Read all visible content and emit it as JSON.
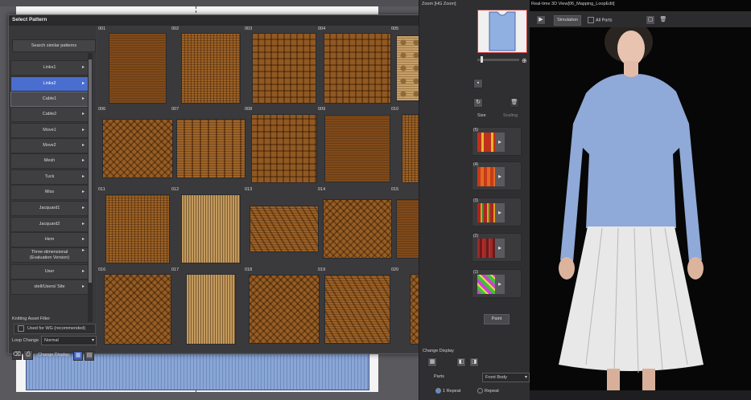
{
  "dialog": {
    "title": "Select Pattern",
    "search_similar": "Search similar patterns",
    "categories": [
      "Links1",
      "Links2",
      "Cable1",
      "Cable2",
      "Move1",
      "Move2",
      "Mesh",
      "Tuck",
      "Miss",
      "Jacquard1",
      "Jacquard2",
      "Hem",
      "Three-dimensional\n(Evaluation Version)",
      "User",
      "stell/Users/ Site"
    ],
    "selected_category": "Links2",
    "filter_label": "Knitting Asset Filter",
    "filter_checkbox": "Used for WG (recommended)",
    "loop_change_label": "Loop Change",
    "loop_change_value": "Normal",
    "change_display_label": "Change Display",
    "patterns": [
      "001",
      "002",
      "003",
      "004",
      "005",
      "006",
      "007",
      "008",
      "009",
      "010",
      "011",
      "012",
      "013",
      "014",
      "015",
      "016",
      "017",
      "018",
      "019",
      "020"
    ],
    "close_glyph": "×",
    "arrow_glyph": "▸",
    "dropdown_glyph": "▾"
  },
  "mid_panel": {
    "zoom_title": "Zoom [HG Zoom]",
    "size_label": "Size",
    "scaling_label": "Scaling",
    "layers": [
      "(5)",
      "(4)",
      "(3)",
      "(2)",
      "(1)"
    ],
    "paint_label": "Paint",
    "change_display": "Change Display",
    "parts_label": "Parts",
    "parts_value": "Front Body",
    "radio_1": "1 Repeat",
    "radio_2": "Repeat"
  },
  "view3d": {
    "title": "Real-time 3D View[06_Mapping_LoopEdit]",
    "simulation": "Simulation",
    "all_parts": "All Parts"
  },
  "colors": {
    "accent": "#4a6ed0",
    "close": "#d23a3a",
    "sweater": "#8fa9d8",
    "skirt": "#e8e8e8"
  }
}
